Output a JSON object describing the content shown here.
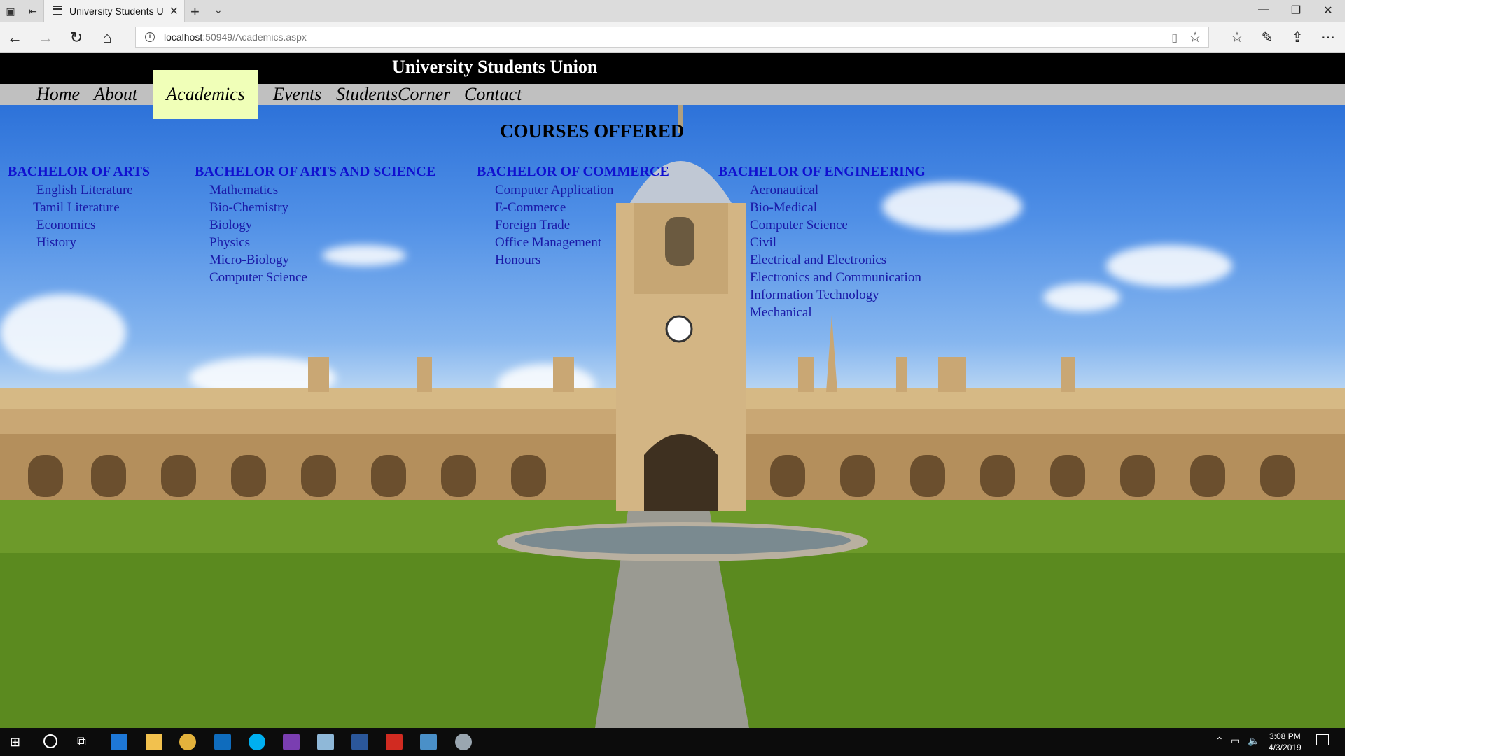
{
  "browser": {
    "tab_title": "University Students Union",
    "url_host": "localhost",
    "url_rest": ":50949/Academics.aspx"
  },
  "site": {
    "title": "University Students Union",
    "menu": [
      "Home",
      "About",
      "Academics",
      "Events",
      "StudentsCorner",
      "Contact"
    ]
  },
  "courses": {
    "heading": "COURSES OFFERED",
    "degrees": [
      {
        "title": "BACHELOR OF ARTS",
        "items": [
          "English Literature",
          "Tamil Literature",
          "Economics",
          "History"
        ]
      },
      {
        "title": "BACHELOR OF ARTS AND SCIENCE",
        "items": [
          "Mathematics",
          "Bio-Chemistry",
          "Biology",
          "Physics",
          "Micro-Biology",
          "Computer Science"
        ]
      },
      {
        "title": "BACHELOR OF COMMERCE",
        "items": [
          "Computer Application",
          "E-Commerce",
          "Foreign Trade",
          "Office Management",
          "Honours"
        ]
      },
      {
        "title": "BACHELOR OF ENGINEERING",
        "items": [
          "Aeronautical",
          "Bio-Medical",
          "Computer Science",
          "Civil",
          "Electrical and Electronics",
          "Electronics and Communication",
          "Information Technology",
          "Mechanical"
        ]
      }
    ]
  },
  "taskbar": {
    "time": "3:08 PM",
    "date": "4/3/2019"
  },
  "colors": {
    "header_bg": "#000000",
    "menu_bg": "#c0c0c0",
    "active_menu_bg": "#f0ffb8",
    "degree_title": "#1010d0",
    "course_text": "#1a1aa8"
  }
}
